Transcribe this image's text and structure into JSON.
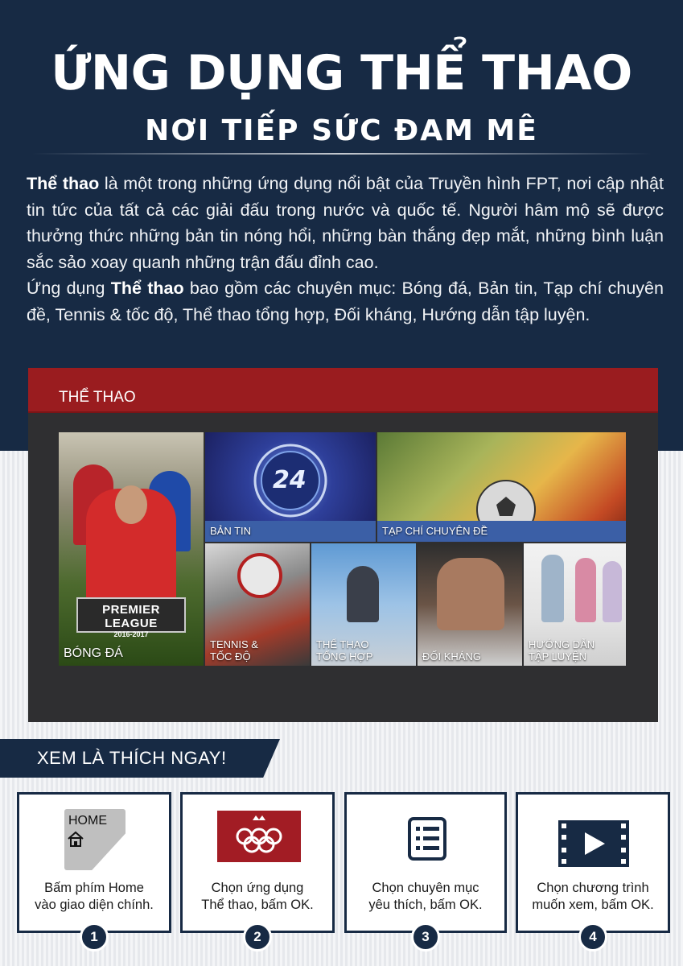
{
  "header": {
    "title": "ỨNG DỤNG THỂ THAO",
    "subtitle": "NƠI TIẾP SỨC ĐAM MÊ"
  },
  "intro": {
    "p1_bold": "Thể thao",
    "p1_rest": " là một trong những ứng dụng nổi bật của Truyền hình FPT, nơi cập nhật tin tức của tất cả các giải đấu trong nước và quốc tế. Người hâm mộ sẽ được thưởng thức những bản tin nóng hổi, những bàn thắng đẹp mắt, những bình luận sắc sảo xoay quanh những trận đấu đỉnh cao.",
    "p2_start": "Ứng dụng ",
    "p2_bold": "Thể thao",
    "p2_rest": " bao gồm các chuyên mục: Bóng đá, Bản tin, Tạp chí chuyên đề, Tennis & tốc độ, Thể thao tổng hợp, Đối kháng, Hướng dẫn tập luyện."
  },
  "tv": {
    "header": "THỂ THAO",
    "tiles": {
      "bongda": {
        "label": "BÓNG ĐÁ",
        "badge_line1": "PREMIER LEAGUE",
        "badge_line2": "2016-2017"
      },
      "bantin": {
        "label": "BẢN TIN",
        "logo_text": "24"
      },
      "tapchi": {
        "label": "TẠP CHÍ CHUYÊN ĐỀ"
      },
      "tennis": {
        "label_line1": "TENNIS &",
        "label_line2": "TỐC ĐỘ"
      },
      "tonghop": {
        "label_line1": "THỂ THAO",
        "label_line2": "TỔNG HỢP"
      },
      "doikhang": {
        "label": "ĐỐI KHÁNG"
      },
      "huongdan": {
        "label_line1": "HƯỚNG DẪN",
        "label_line2": "TẬP LUYỆN"
      }
    }
  },
  "ribbon": {
    "text": "XEM LÀ THÍCH NGAY!"
  },
  "steps": [
    {
      "line1": "Bấm phím Home",
      "line2": "vào giao diện chính.",
      "num": "1",
      "key_label": "HOME"
    },
    {
      "line1": "Chọn ứng dụng",
      "line2": "Thể thao, bấm OK.",
      "num": "2"
    },
    {
      "line1": "Chọn chuyên mục",
      "line2": "yêu thích, bấm OK.",
      "num": "3"
    },
    {
      "line1": "Chọn chương trình",
      "line2": "muốn xem, bấm OK.",
      "num": "4"
    }
  ],
  "colors": {
    "navy": "#172a44",
    "red": "#9a1c1f",
    "tile_blue": "#3b5fa6"
  }
}
